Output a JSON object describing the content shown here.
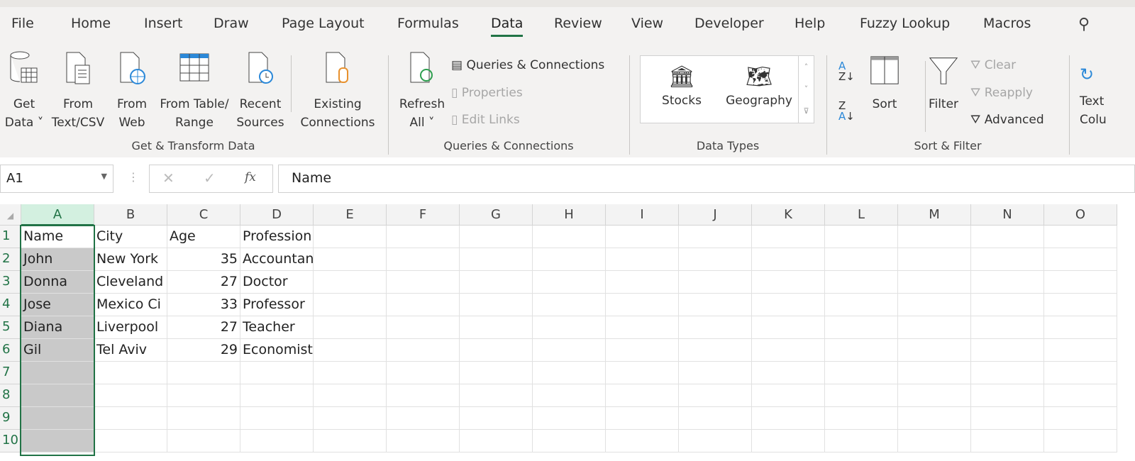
{
  "tabs": [
    "File",
    "Home",
    "Insert",
    "Draw",
    "Page Layout",
    "Formulas",
    "Data",
    "Review",
    "View",
    "Developer",
    "Help",
    "Fuzzy Lookup",
    "Macros"
  ],
  "active_tab": "Data",
  "ribbon": {
    "get_data": [
      "Get",
      "Data ˅"
    ],
    "from_text": [
      "From",
      "Text/CSV"
    ],
    "from_web": [
      "From",
      "Web"
    ],
    "from_table": [
      "From Table/",
      "Range"
    ],
    "recent": [
      "Recent",
      "Sources"
    ],
    "existing": [
      "Existing",
      "Connections"
    ],
    "group1": "Get & Transform Data",
    "refresh": [
      "Refresh",
      "All ˅"
    ],
    "queries": "Queries & Connections",
    "properties": "Properties",
    "edit_links": "Edit Links",
    "group2": "Queries & Connections",
    "stocks": "Stocks",
    "geography": "Geography",
    "group3": "Data Types",
    "sort": "Sort",
    "filter": "Filter",
    "clear": "Clear",
    "reapply": "Reapply",
    "advanced": "Advanced",
    "group4": "Sort & Filter",
    "text_to": [
      "Text",
      "Colu"
    ]
  },
  "name_box": "A1",
  "formula": "Name",
  "fx": "fx",
  "columns": [
    "A",
    "B",
    "C",
    "D",
    "E",
    "F",
    "G",
    "H",
    "I",
    "J",
    "K",
    "L",
    "M",
    "N",
    "O"
  ],
  "rows": [
    [
      "Name",
      "City",
      "Age",
      "Profession"
    ],
    [
      "John",
      "New York",
      "35",
      "Accountant"
    ],
    [
      "Donna",
      "Cleveland",
      "27",
      "Doctor"
    ],
    [
      "Jose",
      "Mexico Ci",
      "33",
      "Professor"
    ],
    [
      "Diana",
      "Liverpool",
      "27",
      "Teacher"
    ],
    [
      "Gil",
      "Tel Aviv",
      "29",
      "Economist"
    ],
    [],
    [],
    [],
    []
  ],
  "accent": "#217346"
}
